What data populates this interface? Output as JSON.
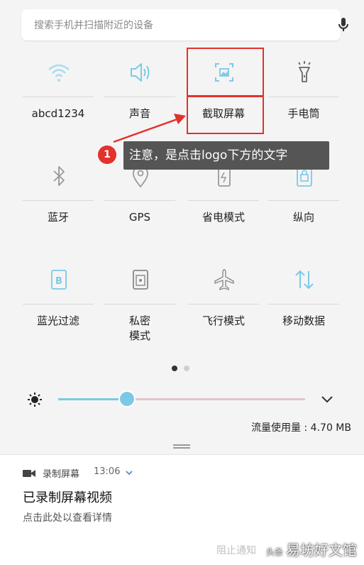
{
  "search": {
    "placeholder": "搜索手机并扫描附近的设备"
  },
  "tiles": [
    {
      "label": "abcd1234",
      "icon": "wifi-icon"
    },
    {
      "label": "声音",
      "icon": "speaker-icon"
    },
    {
      "label": "截取屏幕",
      "icon": "screenshot-icon"
    },
    {
      "label": "手电筒",
      "icon": "flashlight-icon"
    },
    {
      "label": "蓝牙",
      "icon": "bluetooth-icon"
    },
    {
      "label": "GPS",
      "icon": "location-icon"
    },
    {
      "label": "省电模式",
      "icon": "power-saving-icon"
    },
    {
      "label": "纵向",
      "icon": "portrait-lock-icon"
    },
    {
      "label": "蓝光过滤",
      "icon": "blue-light-filter-icon"
    },
    {
      "label": "私密\n模式",
      "icon": "private-mode-icon"
    },
    {
      "label": "飞行模式",
      "icon": "airplane-icon"
    },
    {
      "label": "移动数据",
      "icon": "mobile-data-icon"
    }
  ],
  "annotation": {
    "badge": "1",
    "text": "注意，是点击logo下方的文字"
  },
  "pager": {
    "pages": 2,
    "active": 1
  },
  "brightness": {
    "level": 0.28
  },
  "data_usage": "流量使用量 : 4.70 MB",
  "notification": {
    "app": "录制屏幕",
    "time": "13:06",
    "title": "已录制屏幕视频",
    "detail": "点击此处以查看详情",
    "action": "阻止通知"
  },
  "watermark": {
    "prefix": "头条",
    "name": "易坊好文馆"
  },
  "colors": {
    "accent": "#7cc9e6",
    "highlight": "#e3312c",
    "tooltip": "#555555"
  }
}
